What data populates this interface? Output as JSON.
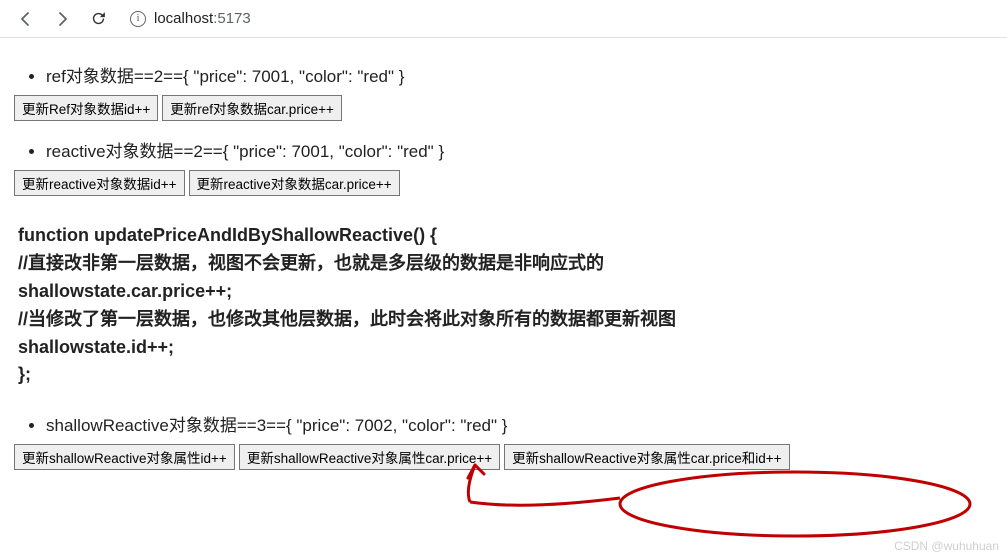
{
  "browser": {
    "url_host": "localhost",
    "url_port": ":5173"
  },
  "sections": {
    "ref": {
      "header": "ref对象数据==2=={ \"price\": 7001, \"color\": \"red\" }",
      "buttons": [
        "更新Ref对象数据id++",
        "更新ref对象数据car.price++"
      ]
    },
    "reactive": {
      "header": "reactive对象数据==2=={ \"price\": 7001, \"color\": \"red\" }",
      "buttons": [
        "更新reactive对象数据id++",
        "更新reactive对象数据car.price++"
      ]
    },
    "code": "function updatePriceAndIdByShallowReactive() {\n//直接改非第一层数据，视图不会更新，也就是多层级的数据是非响应式的\nshallowstate.car.price++;\n//当修改了第一层数据，也修改其他层数据，此时会将此对象所有的数据都更新视图\nshallowstate.id++;\n};",
    "shallow": {
      "header": "shallowReactive对象数据==3=={ \"price\": 7002, \"color\": \"red\" }",
      "buttons": [
        "更新shallowReactive对象属性id++",
        "更新shallowReactive对象属性car.price++",
        "更新shallowReactive对象属性car.price和id++"
      ]
    }
  },
  "watermark": "CSDN @wuhuhuan"
}
